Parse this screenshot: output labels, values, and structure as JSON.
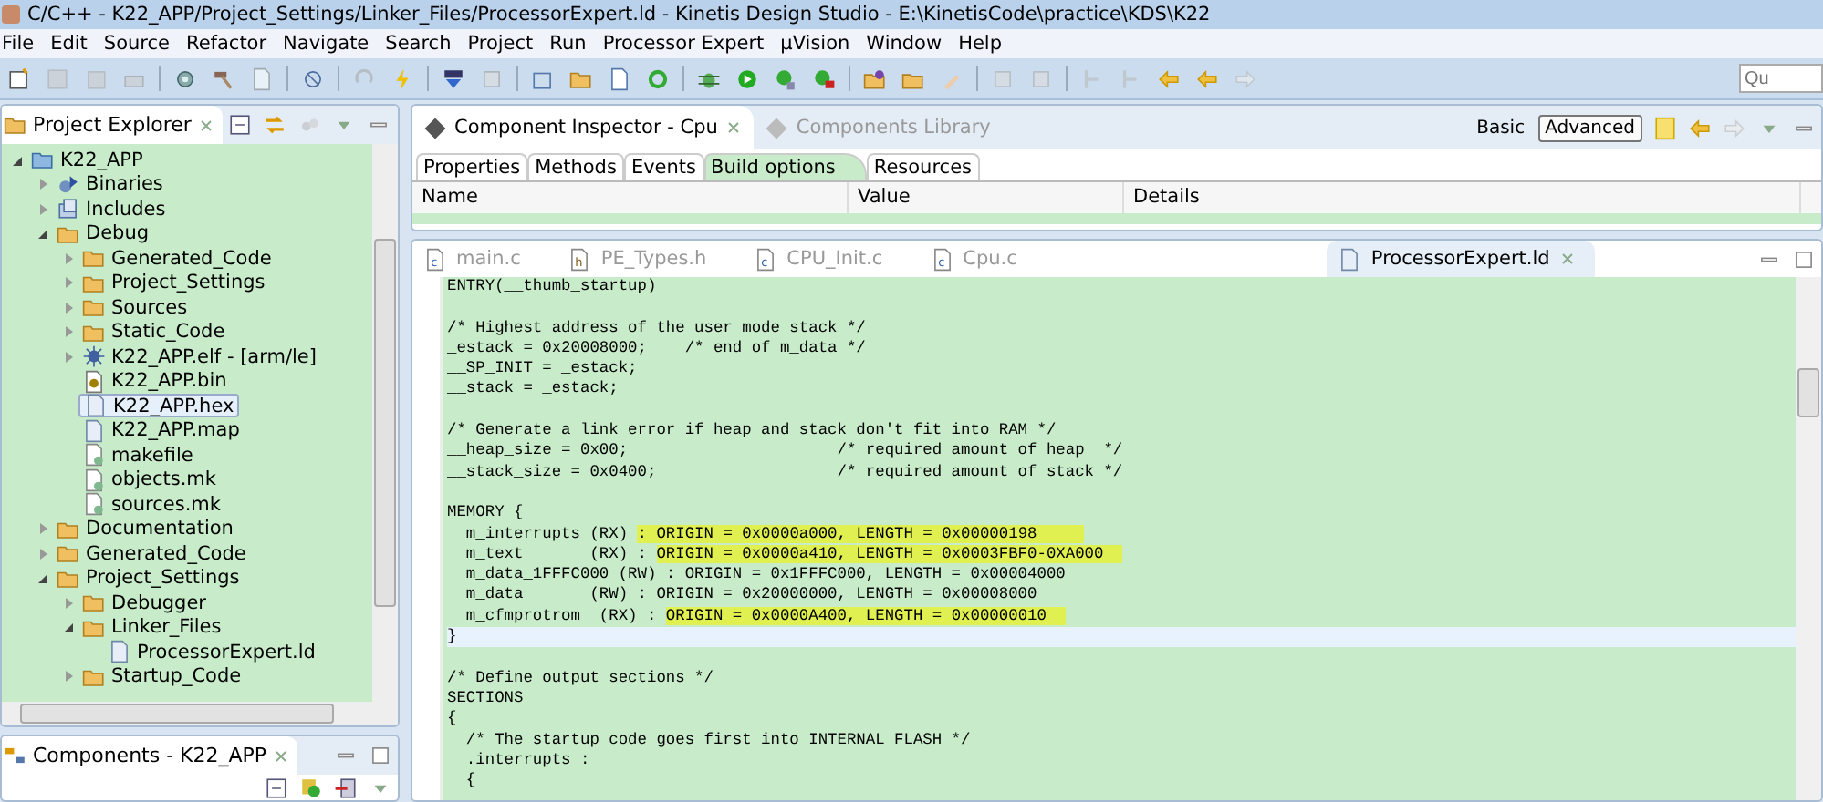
{
  "window": {
    "title": "C/C++ - K22_APP/Project_Settings/Linker_Files/ProcessorExpert.ld - Kinetis Design Studio - E:\\KinetisCode\\practice\\KDS\\K22"
  },
  "menu": [
    "File",
    "Edit",
    "Source",
    "Refactor",
    "Navigate",
    "Search",
    "Project",
    "Run",
    "Processor Expert",
    "µVision",
    "Window",
    "Help"
  ],
  "quick_access": {
    "placeholder": "Qu"
  },
  "project_explorer": {
    "title": "Project Explorer",
    "tree": [
      {
        "label": "K22_APP",
        "kind": "project",
        "expanded": true,
        "selected": false,
        "children": [
          {
            "label": "Binaries",
            "kind": "binaries",
            "expanded": false,
            "selected": false
          },
          {
            "label": "Includes",
            "kind": "includes",
            "expanded": false,
            "selected": false
          },
          {
            "label": "Debug",
            "kind": "folder",
            "expanded": true,
            "selected": false,
            "children": [
              {
                "label": "Generated_Code",
                "kind": "folder",
                "expanded": false,
                "selected": false
              },
              {
                "label": "Project_Settings",
                "kind": "folder",
                "expanded": false,
                "selected": false
              },
              {
                "label": "Sources",
                "kind": "folder",
                "expanded": false,
                "selected": false
              },
              {
                "label": "Static_Code",
                "kind": "folder",
                "expanded": false,
                "selected": false
              },
              {
                "label": "K22_APP.elf - [arm/le]",
                "kind": "elf",
                "expanded": false,
                "selected": false
              },
              {
                "label": "K22_APP.bin",
                "kind": "bin",
                "selected": false
              },
              {
                "label": "K22_APP.hex",
                "kind": "file",
                "selected": true
              },
              {
                "label": "K22_APP.map",
                "kind": "file",
                "selected": false
              },
              {
                "label": "makefile",
                "kind": "make",
                "selected": false
              },
              {
                "label": "objects.mk",
                "kind": "make",
                "selected": false
              },
              {
                "label": "sources.mk",
                "kind": "make",
                "selected": false
              }
            ]
          },
          {
            "label": "Documentation",
            "kind": "folder",
            "expanded": false,
            "selected": false
          },
          {
            "label": "Generated_Code",
            "kind": "folder",
            "expanded": false,
            "selected": false
          },
          {
            "label": "Project_Settings",
            "kind": "folder",
            "expanded": true,
            "selected": false,
            "children": [
              {
                "label": "Debugger",
                "kind": "folder",
                "expanded": false,
                "selected": false
              },
              {
                "label": "Linker_Files",
                "kind": "folder",
                "expanded": true,
                "selected": false,
                "children": [
                  {
                    "label": "ProcessorExpert.ld",
                    "kind": "file",
                    "selected": false
                  }
                ]
              },
              {
                "label": "Startup_Code",
                "kind": "folder",
                "expanded": false,
                "selected": false
              }
            ]
          }
        ]
      }
    ]
  },
  "components_panel": {
    "title": "Components - K22_APP"
  },
  "inspector": {
    "views": [
      {
        "label": "Component Inspector - Cpu",
        "selected": true
      },
      {
        "label": "Components Library",
        "selected": false
      }
    ],
    "modes": [
      {
        "label": "Basic",
        "selected": false
      },
      {
        "label": "Advanced",
        "selected": true
      }
    ],
    "tabs": [
      {
        "label": "Properties",
        "selected": false
      },
      {
        "label": "Methods",
        "selected": false
      },
      {
        "label": "Events",
        "selected": false
      },
      {
        "label": "Build options",
        "selected": true
      },
      {
        "label": "Resources",
        "selected": false
      }
    ],
    "columns": [
      "Name",
      "Value",
      "Details"
    ]
  },
  "editor": {
    "tabs": [
      {
        "label": "main.c",
        "kind": "c",
        "selected": false
      },
      {
        "label": "PE_Types.h",
        "kind": "h",
        "selected": false
      },
      {
        "label": "CPU_Init.c",
        "kind": "c",
        "selected": false
      },
      {
        "label": "Cpu.c",
        "kind": "c",
        "selected": false
      },
      {
        "label": "ProcessorExpert.ld",
        "kind": "file",
        "selected": true
      }
    ],
    "lines": [
      {
        "current": false,
        "segments": [
          {
            "text": "ENTRY(__thumb_startup)",
            "highlighted": false
          }
        ]
      },
      {
        "current": false
      },
      {
        "current": false,
        "segments": [
          {
            "text": "/* Highest address of the user mode stack */",
            "highlighted": false
          }
        ]
      },
      {
        "current": false,
        "segments": [
          {
            "text": "_estack = 0x20008000;    /* end of m_data */",
            "highlighted": false
          }
        ]
      },
      {
        "current": false,
        "segments": [
          {
            "text": "__SP_INIT = _estack;",
            "highlighted": false
          }
        ]
      },
      {
        "current": false,
        "segments": [
          {
            "text": "__stack = _estack;",
            "highlighted": false
          }
        ]
      },
      {
        "current": false
      },
      {
        "current": false,
        "segments": [
          {
            "text": "/* Generate a link error if heap and stack don't fit into RAM */",
            "highlighted": false
          }
        ]
      },
      {
        "current": false,
        "segments": [
          {
            "text": "__heap_size = 0x00;                      /* required amount of heap  */",
            "highlighted": false
          }
        ]
      },
      {
        "current": false,
        "segments": [
          {
            "text": "__stack_size = 0x0400;                   /* required amount of stack */",
            "highlighted": false
          }
        ]
      },
      {
        "current": false
      },
      {
        "current": false,
        "segments": [
          {
            "text": "MEMORY {",
            "highlighted": false
          }
        ]
      },
      {
        "current": false,
        "segments": [
          {
            "text": "  m_interrupts (RX) ",
            "highlighted": false
          },
          {
            "text": ": ORIGIN = 0x0000a000, LENGTH = 0x00000198     ",
            "highlighted": true
          }
        ]
      },
      {
        "current": false,
        "segments": [
          {
            "text": "  m_text       (RX) : ",
            "highlighted": false
          },
          {
            "text": "ORIGIN = 0x0000a410, LENGTH = 0x0003FBF0-0XA000  ",
            "highlighted": true
          }
        ]
      },
      {
        "current": false,
        "segments": [
          {
            "text": "  m_data_1FFFC000 (RW) : ORIGIN = 0x1FFFC000, LENGTH = 0x00004000",
            "highlighted": false
          }
        ]
      },
      {
        "current": false,
        "segments": [
          {
            "text": "  m_data       (RW) : ORIGIN = 0x20000000, LENGTH = 0x00008000",
            "highlighted": false
          }
        ]
      },
      {
        "current": false,
        "segments": [
          {
            "text": "  m_cfmprotrom  (RX) : ",
            "highlighted": false
          },
          {
            "text": "ORIGIN = 0x0000A400, LENGTH = 0x00000010  ",
            "highlighted": true
          }
        ]
      },
      {
        "current": true,
        "segments": [
          {
            "text": "}",
            "highlighted": false
          }
        ]
      },
      {
        "current": false
      },
      {
        "current": false,
        "segments": [
          {
            "text": "/* Define output sections */",
            "highlighted": false
          }
        ]
      },
      {
        "current": false,
        "segments": [
          {
            "text": "SECTIONS",
            "highlighted": false
          }
        ]
      },
      {
        "current": false,
        "segments": [
          {
            "text": "{",
            "highlighted": false
          }
        ]
      },
      {
        "current": false,
        "segments": [
          {
            "text": "  /* The startup code goes first into INTERNAL_FLASH */",
            "highlighted": false
          }
        ]
      },
      {
        "current": false,
        "segments": [
          {
            "text": "  .interrupts :",
            "highlighted": false
          }
        ]
      },
      {
        "current": false,
        "segments": [
          {
            "text": "  {",
            "highlighted": false
          }
        ]
      }
    ]
  }
}
